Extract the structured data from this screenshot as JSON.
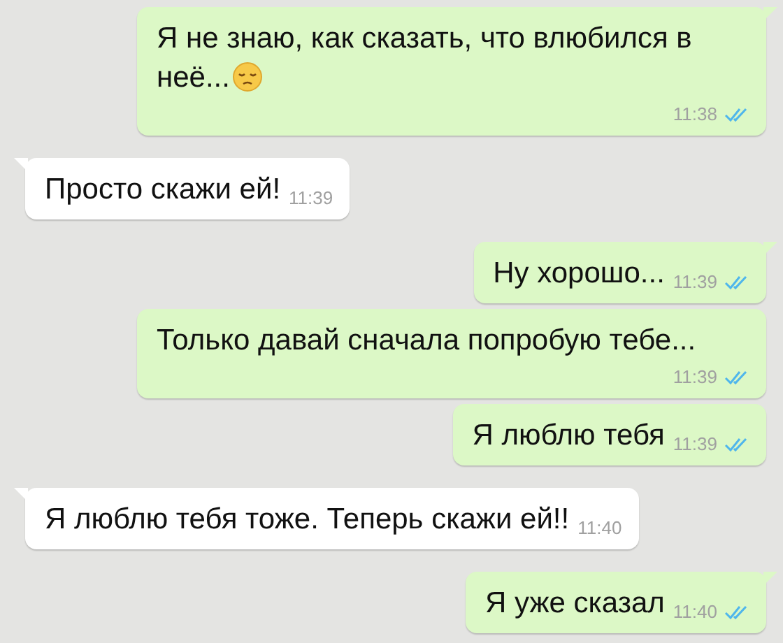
{
  "messages": [
    {
      "kind": "outgoing",
      "text": "Я не знаю, как сказать, что влюбился в неё...",
      "emoji": true,
      "time": "11:38",
      "read": true
    },
    {
      "kind": "incoming",
      "text": "Просто скажи ей!",
      "time": "11:39"
    },
    {
      "kind": "outgoing",
      "text": "Ну хорошо...",
      "time": "11:39",
      "read": true
    },
    {
      "kind": "outgoing",
      "text": "Только давай сначала попробую тебе...",
      "time": "11:39",
      "read": true
    },
    {
      "kind": "outgoing",
      "text": "Я люблю тебя",
      "time": "11:39",
      "read": true
    },
    {
      "kind": "incoming",
      "text": "Я люблю тебя тоже. Теперь скажи ей!!",
      "time": "11:40"
    },
    {
      "kind": "outgoing",
      "text": "Я уже сказал",
      "time": "11:40",
      "read": true
    }
  ]
}
